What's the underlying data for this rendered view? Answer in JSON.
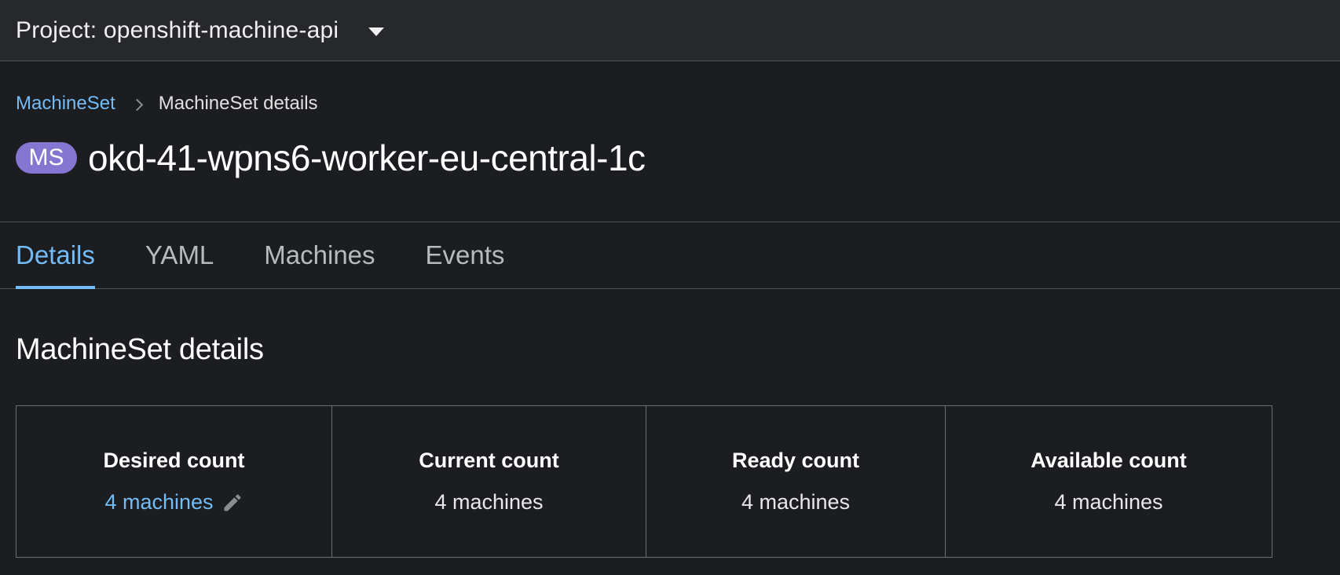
{
  "topbar": {
    "project_label": "Project: openshift-machine-api",
    "project_icon": "caret-down-icon"
  },
  "breadcrumb": {
    "parent": "MachineSet",
    "current": "MachineSet details"
  },
  "header": {
    "badge": "MS",
    "title": "okd-41-wpns6-worker-eu-central-1c"
  },
  "tabs": [
    {
      "label": "Details",
      "active": true
    },
    {
      "label": "YAML",
      "active": false
    },
    {
      "label": "Machines",
      "active": false
    },
    {
      "label": "Events",
      "active": false
    }
  ],
  "section": {
    "title": "MachineSet details"
  },
  "counts": [
    {
      "label": "Desired count",
      "value": "4 machines",
      "editable": true
    },
    {
      "label": "Current count",
      "value": "4 machines",
      "editable": false
    },
    {
      "label": "Ready count",
      "value": "4 machines",
      "editable": false
    },
    {
      "label": "Available count",
      "value": "4 machines",
      "editable": false
    }
  ],
  "colors": {
    "accent": "#73bcf7",
    "badge": "#8476d1",
    "background": "#1b1d21",
    "topbar": "#26282c"
  }
}
